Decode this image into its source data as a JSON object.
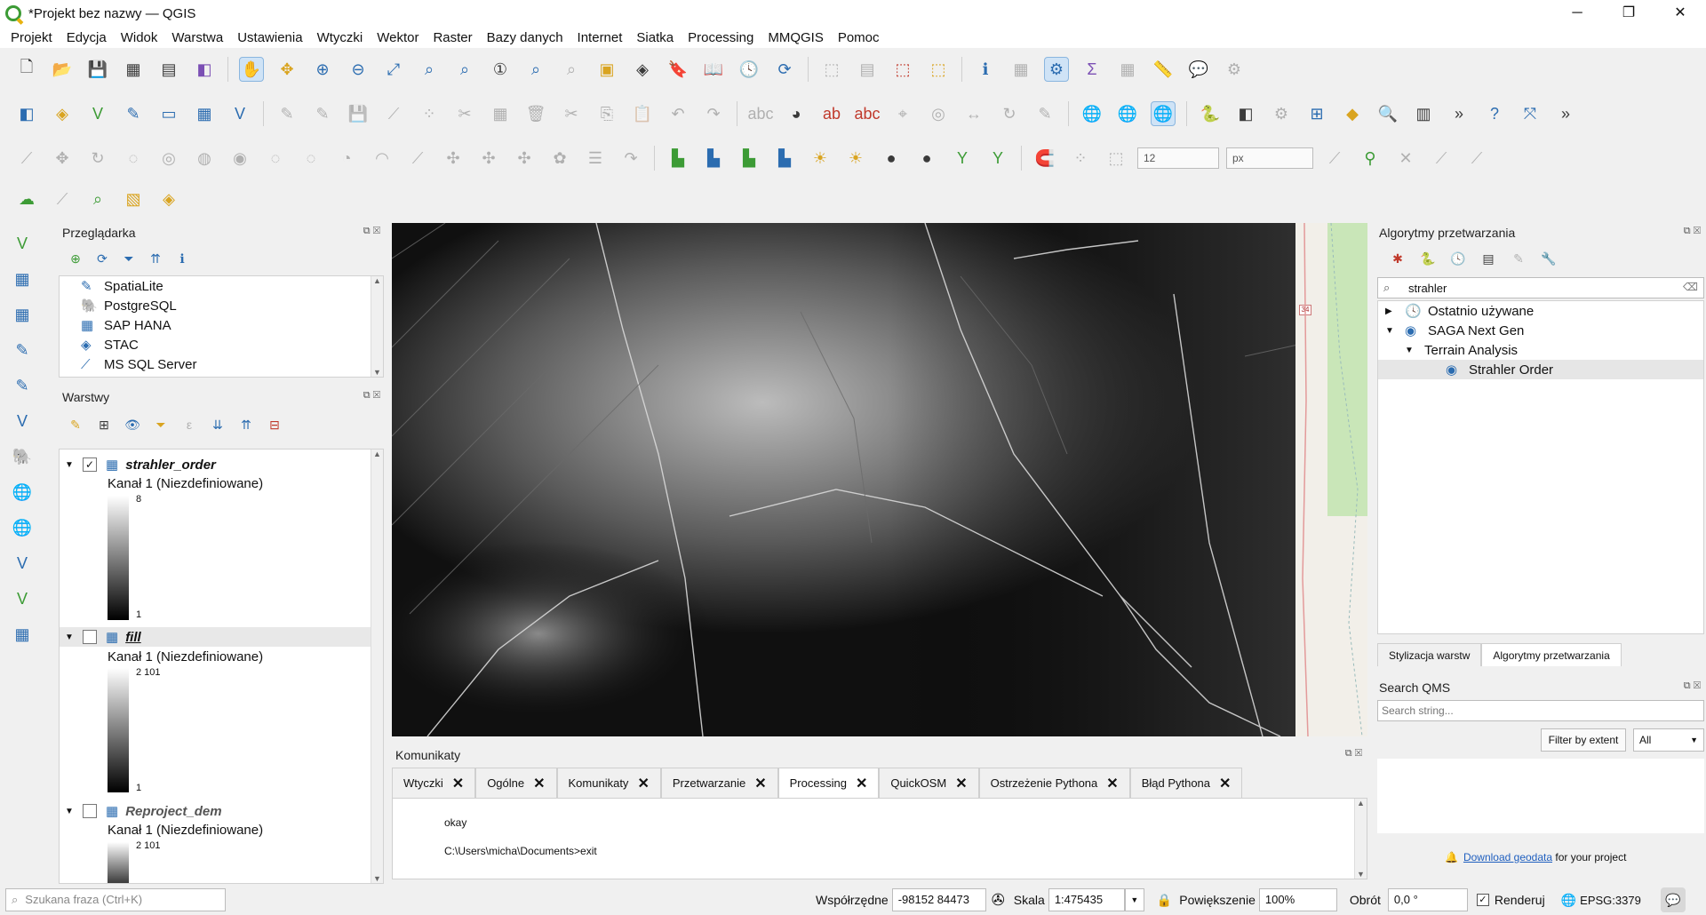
{
  "window": {
    "title": "*Projekt bez nazwy — QGIS",
    "minimize": "─",
    "maximize": "❐",
    "close": "✕"
  },
  "menu": [
    "Projekt",
    "Edycja",
    "Widok",
    "Warstwa",
    "Ustawienia",
    "Wtyczki",
    "Wektor",
    "Raster",
    "Bazy danych",
    "Internet",
    "Siatka",
    "Processing",
    "MMQGIS",
    "Pomoc"
  ],
  "toolbar": {
    "snap_tolerance": "12",
    "snap_unit": "px"
  },
  "browser": {
    "title": "Przeglądarka",
    "items": [
      "SpatiaLite",
      "PostgreSQL",
      "SAP HANA",
      "STAC",
      "MS SQL Server"
    ]
  },
  "layers": {
    "title": "Warstwy",
    "items": [
      {
        "name": "strahler_order",
        "checked": true,
        "band": "Kanał 1 (Niezdefiniowane)",
        "max": "8",
        "min": "1"
      },
      {
        "name": "fill",
        "checked": false,
        "band": "Kanał 1 (Niezdefiniowane)",
        "max": "2 101",
        "min": "1"
      },
      {
        "name": "Reproject_dem",
        "checked": false,
        "band": "Kanał 1 (Niezdefiniowane)",
        "max": "2 101",
        "min": ""
      }
    ]
  },
  "processing": {
    "title": "Algorytmy przetwarzania",
    "search": "strahler",
    "tree": [
      "Ostatnio używane",
      "SAGA Next Gen",
      "Terrain Analysis",
      "Strahler Order"
    ],
    "bottom_tabs": [
      "Stylizacja warstw",
      "Algorytmy przetwarzania"
    ]
  },
  "qms": {
    "title": "Search QMS",
    "placeholder": "Search string...",
    "filter_btn": "Filter by extent",
    "filter_select": "All",
    "download_link": "Download geodata",
    "download_rest": " for your project"
  },
  "messages": {
    "title": "Komunikaty",
    "tabs": [
      "Wtyczki",
      "Ogólne",
      "Komunikaty",
      "Przetwarzanie",
      "Processing",
      "QuickOSM",
      "Ostrzeżenie Pythona",
      "Błąd Pythona"
    ],
    "active_tab": "Processing",
    "lines": [
      "okay",
      "C:\\Users\\micha\\Documents>exit"
    ]
  },
  "status": {
    "search_placeholder": "Szukana fraza (Ctrl+K)",
    "coord_label": "Współrzędne",
    "coord": "-98152  84473",
    "scale_label": "Skala",
    "scale": "1:475435",
    "zoom_label": "Powiększenie",
    "zoom": "100%",
    "rot_label": "Obrót",
    "rot": "0,0 °",
    "render_label": "Renderuj",
    "crs": "EPSG:3379"
  },
  "map_side_label": "34"
}
